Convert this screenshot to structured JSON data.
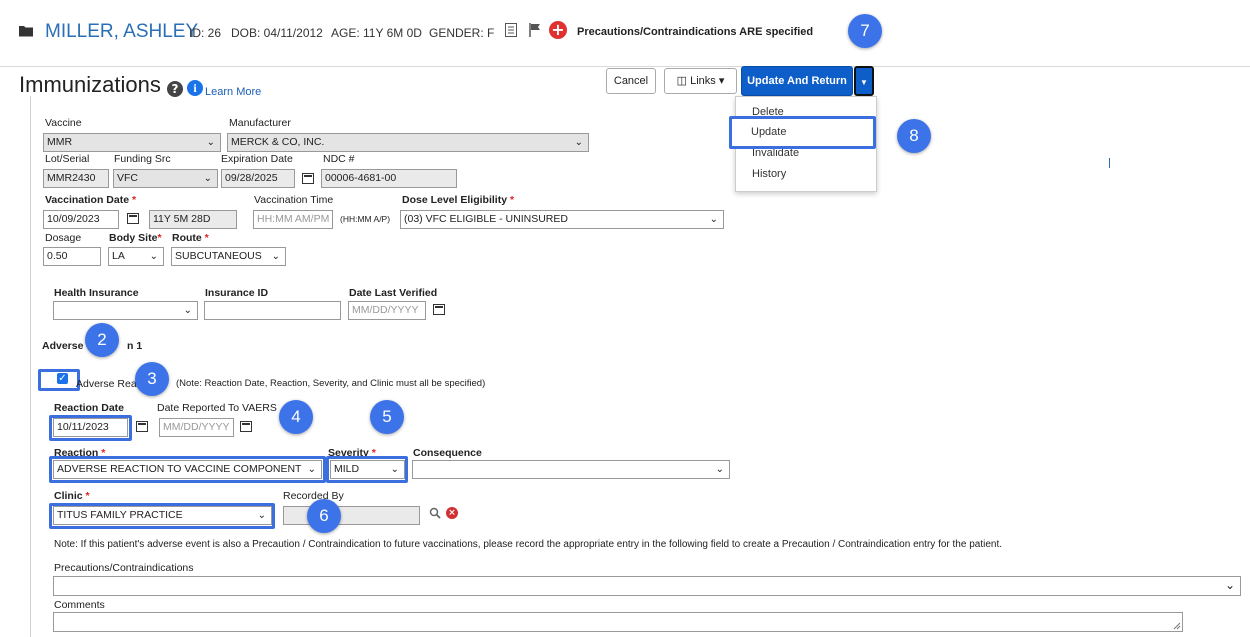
{
  "patient": {
    "name": "MILLER, ASHLEY",
    "id": "ID: 26",
    "dob": "DOB: 04/11/2012",
    "age": "AGE: 11Y 6M 0D",
    "gender": "GENDER: F",
    "precautions": "Precautions/Contraindications ARE specified"
  },
  "page": {
    "title": "Immunizations",
    "learn_more": "Learn More"
  },
  "toolbar": {
    "cancel": "Cancel",
    "links": "Links",
    "update_return": "Update And Return"
  },
  "menu": {
    "items": [
      "Delete",
      "Update",
      "Invalidate",
      "History"
    ]
  },
  "form": {
    "vaccine_label": "Vaccine",
    "vaccine_value": "MMR",
    "manufacturer_label": "Manufacturer",
    "manufacturer_value": "MERCK & CO, INC.",
    "lot_label": "Lot/Serial",
    "lot_value": "MMR2430",
    "funding_label": "Funding Src",
    "funding_value": "VFC",
    "exp_label": "Expiration Date",
    "exp_value": "09/28/2025",
    "ndc_label": "NDC #",
    "ndc_value": "00006-4681-00",
    "vacc_date_label": "Vaccination Date",
    "vacc_date_value": "10/09/2023",
    "age_at_vacc": "11Y 5M 28D",
    "vacc_time_label": "Vaccination Time",
    "vacc_time_placeholder": "HH:MM AM/PM",
    "vacc_time_hint": "(HH:MM A/P)",
    "dose_elig_label": "Dose Level Eligibility",
    "dose_elig_value": "(03) VFC ELIGIBLE - UNINSURED",
    "dosage_label": "Dosage",
    "dosage_value": "0.50",
    "body_site_label": "Body Site",
    "body_site_value": "LA",
    "route_label": "Route",
    "route_value": "SUBCUTANEOUS",
    "health_ins_label": "Health Insurance",
    "ins_id_label": "Insurance ID",
    "date_verified_label": "Date Last Verified",
    "date_placeholder": "MM/DD/YYYY"
  },
  "adverse": {
    "section_title_start": "Adverse",
    "section_title_end": "n 1",
    "checkbox_label": "Adverse Rea",
    "note_text": "(Note: Reaction Date, Reaction, Severity, and Clinic must all be specified)",
    "reaction_date_label": "Reaction Date",
    "reaction_date_value": "10/11/2023",
    "vaers_label": "Date Reported To VAERS",
    "reaction_label": "Reaction",
    "reaction_value": "ADVERSE REACTION TO VACCINE COMPONENT",
    "severity_label": "Severity",
    "severity_value": "MILD",
    "consequence_label": "Consequence",
    "clinic_label": "Clinic",
    "clinic_value": "TITUS FAMILY PRACTICE",
    "recorded_by_label": "Recorded By",
    "precaution_note": "Note: If this patient's adverse event is also a Precaution / Contraindication to future vaccinations, please record the appropriate entry in the following field to create a Precaution / Contraindication entry for the patient.",
    "precautions_label": "Precautions/Contraindications",
    "comments_label": "Comments"
  },
  "markers": [
    "2",
    "3",
    "4",
    "5",
    "6",
    "7",
    "8"
  ],
  "colors": {
    "accent": "#3c73e8",
    "primary_button": "#0d5ec9",
    "name": "#2a6fb5"
  }
}
